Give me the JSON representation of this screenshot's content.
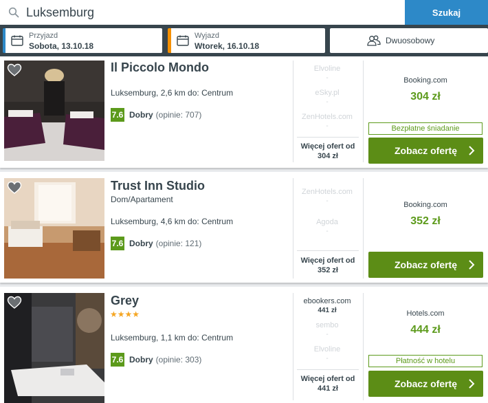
{
  "search": {
    "query": "Luksemburg",
    "button_label": "Szukaj"
  },
  "dates": {
    "checkin": {
      "label": "Przyjazd",
      "value": "Sobota, 13.10.18"
    },
    "checkout": {
      "label": "Wyjazd",
      "value": "Wtorek, 16.10.18"
    },
    "guests": {
      "label": "Dwuosobowy"
    }
  },
  "colors": {
    "accent_blue": "#2d89c8",
    "accent_orange": "#f48f00",
    "rating_green": "#5c9a1b",
    "cta_green": "#5c8d16",
    "dark_bar": "#37454d"
  },
  "hotels": [
    {
      "name": "Il Piccolo Mondo",
      "type": "",
      "stars": "",
      "location": "Luksemburg, 2,6 km do: Centrum",
      "rating": "7.6",
      "rating_label": "Dobry",
      "reviews": "(opinie: 707)",
      "offers": [
        {
          "site": "Elvoline",
          "price": "-"
        },
        {
          "site": "eSky.pl",
          "price": "-"
        },
        {
          "site": "ZenHotels.com",
          "price": "-"
        }
      ],
      "more_offers_label": "Więcej ofert od",
      "more_offers_price": "304 zł",
      "best_site": "Booking.com",
      "best_price": "304 zł",
      "perk": "Bezpłatne śniadanie",
      "cta": "Zobacz ofertę"
    },
    {
      "name": "Trust Inn Studio",
      "type": "Dom/Apartament",
      "stars": "",
      "location": "Luksemburg, 4,6 km do: Centrum",
      "rating": "7.6",
      "rating_label": "Dobry",
      "reviews": "(opinie: 121)",
      "offers": [
        {
          "site": "ZenHotels.com",
          "price": "-"
        },
        {
          "site": "Agoda",
          "price": "-"
        }
      ],
      "more_offers_label": "Więcej ofert od",
      "more_offers_price": "352 zł",
      "best_site": "Booking.com",
      "best_price": "352 zł",
      "perk": "",
      "cta": "Zobacz ofertę"
    },
    {
      "name": "Grey",
      "type": "",
      "stars": "★★★★",
      "location": "Luksemburg, 1,1 km do: Centrum",
      "rating": "7.6",
      "rating_label": "Dobry",
      "reviews": "(opinie: 303)",
      "offers": [
        {
          "site": "ebookers.com",
          "price": "441 zł"
        },
        {
          "site": "sembo",
          "price": "-"
        },
        {
          "site": "Elvoline",
          "price": "-"
        }
      ],
      "more_offers_label": "Więcej ofert od",
      "more_offers_price": "441 zł",
      "best_site": "Hotels.com",
      "best_price": "444 zł",
      "perk": "Płatność w hotelu",
      "cta": "Zobacz ofertę"
    }
  ]
}
